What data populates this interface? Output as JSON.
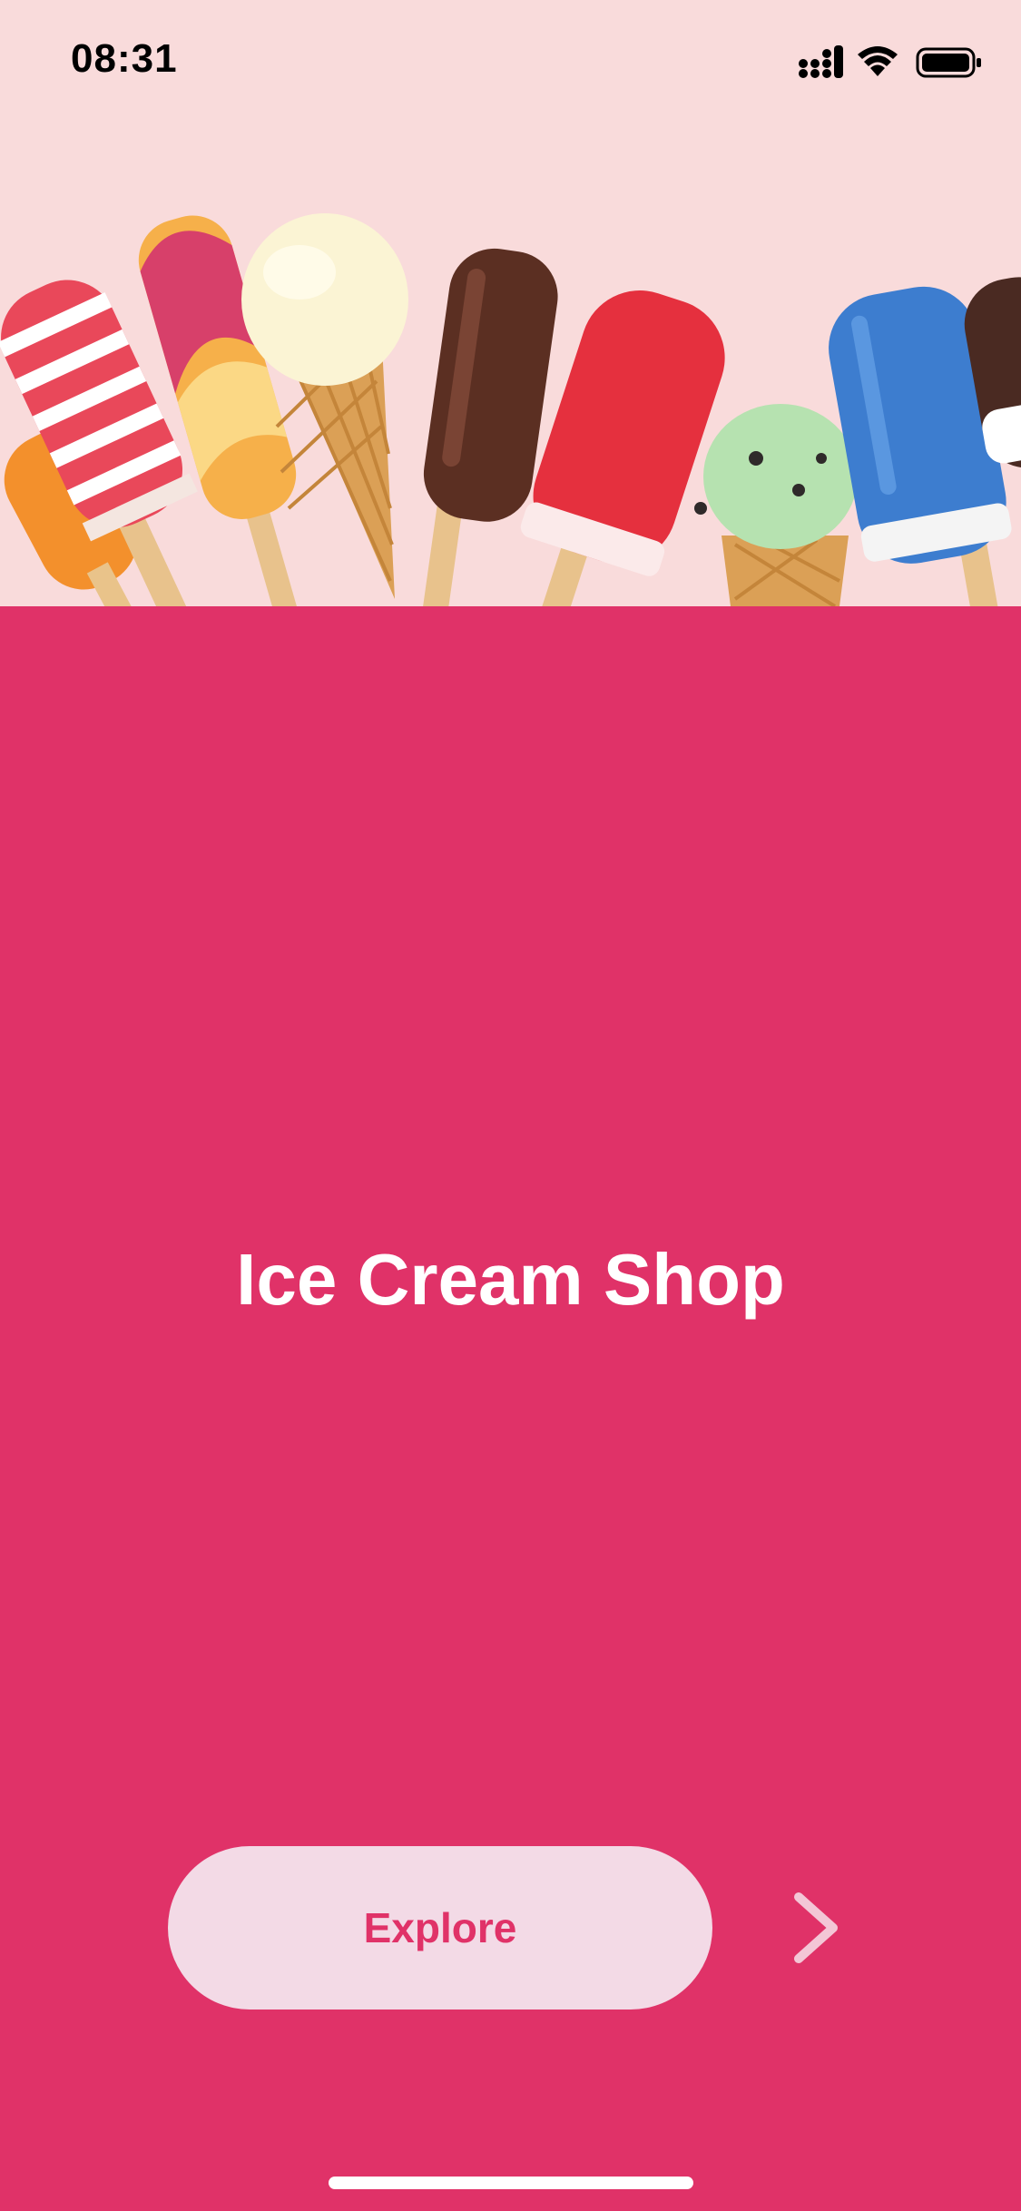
{
  "status_bar": {
    "time": "08:31",
    "icons": [
      "cellular-signal-icon",
      "wifi-icon",
      "battery-icon"
    ]
  },
  "hero": {
    "image": "ice-cream-assortment-image"
  },
  "main": {
    "title": "Ice Cream Shop"
  },
  "actions": {
    "explore_label": "Explore",
    "next_icon": "chevron-right-icon"
  },
  "colors": {
    "background": "#e03268",
    "hero_background": "#f9dbdb",
    "button_background": "#f3dae6",
    "button_text": "#e03268",
    "title_text": "#ffffff"
  }
}
